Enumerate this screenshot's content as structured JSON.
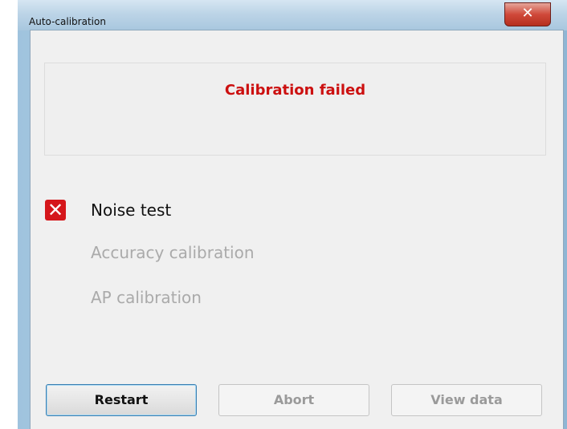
{
  "window": {
    "title": "Auto-calibration",
    "close_glyph": "✕"
  },
  "status": {
    "message": "Calibration failed",
    "color": "#cc1010"
  },
  "steps": [
    {
      "label": "Noise test",
      "state": "failed",
      "icon": "error-x-icon",
      "icon_glyph": "✕"
    },
    {
      "label": "Accuracy calibration",
      "state": "pending"
    },
    {
      "label": "AP calibration",
      "state": "pending"
    }
  ],
  "buttons": {
    "restart": "Restart",
    "abort": "Abort",
    "view_data": "View data"
  }
}
